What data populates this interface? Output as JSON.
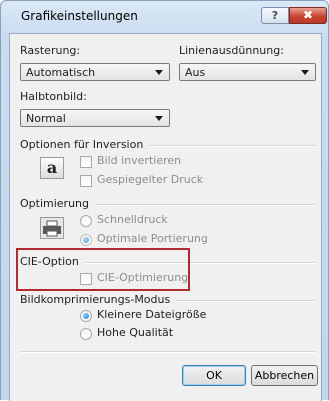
{
  "window": {
    "title": "Grafikeinstellungen",
    "help_label": "?",
    "close_label": "✖"
  },
  "rasterung": {
    "label": "Rasterung:",
    "value": "Automatisch"
  },
  "linienausduennung": {
    "label": "Linienausdünnung:",
    "value": "Aus"
  },
  "halbtonbild": {
    "label": "Halbtonbild:",
    "value": "Normal"
  },
  "inversion": {
    "title": "Optionen für Inversion",
    "icon_letter": "a",
    "bild_invertieren": {
      "label": "Bild invertieren",
      "checked": false,
      "enabled": false
    },
    "gespiegelter_druck": {
      "label": "Gespiegelter Druck",
      "checked": false,
      "enabled": false
    }
  },
  "optimierung": {
    "title": "Optimierung",
    "schnelldruck": {
      "label": "Schnelldruck",
      "selected": false,
      "enabled": false
    },
    "optimale_portierung": {
      "label": "Optimale Portierung",
      "selected": true,
      "enabled": false
    }
  },
  "cie": {
    "title": "CIE-Option",
    "cie_optimierung": {
      "label": "CIE-Optimierung",
      "checked": false,
      "enabled": false
    },
    "highlight_color": "#b02a32"
  },
  "bildkompression": {
    "title": "Bildkomprimierungs-Modus",
    "kleinere_dateigroesse": {
      "label": "Kleinere Dateigröße",
      "selected": true
    },
    "hohe_qualitaet": {
      "label": "Hohe Qualität",
      "selected": false
    }
  },
  "buttons": {
    "ok": "OK",
    "cancel": "Abbrechen"
  }
}
